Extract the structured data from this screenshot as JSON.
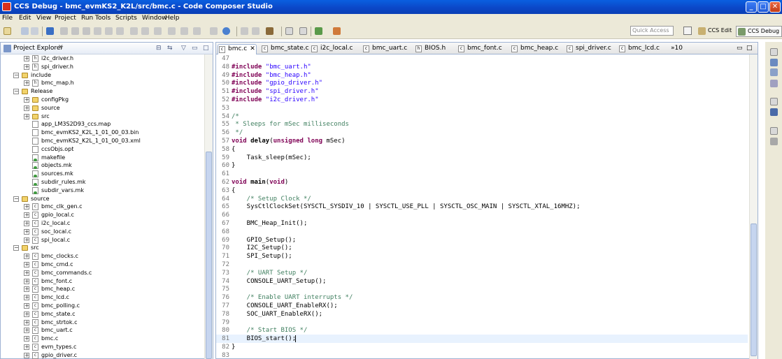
{
  "window": {
    "title": "CCS Debug - bmc_evmKS2_K2L/src/bmc.c - Code Composer Studio",
    "minimize": "_",
    "maximize": "□",
    "close": "✕"
  },
  "menu": [
    "File",
    "Edit",
    "View",
    "Project",
    "Run",
    "Tools",
    "Scripts",
    "Window",
    "Help"
  ],
  "toolbar": {
    "quick_access_placeholder": "Quick Access",
    "perspectives": [
      "CCS Edit",
      "CCS Debug"
    ]
  },
  "explorer": {
    "title": "Project Explorer",
    "close": "✕",
    "buttons": {
      "collapse": "⊟",
      "link": "⇆",
      "menu": "▽",
      "minimize": "▭",
      "maximize": "□"
    },
    "items": [
      {
        "label": "i2c_driver.h",
        "indent": 2,
        "icon": "hfile",
        "expand": "+"
      },
      {
        "label": "spi_driver.h",
        "indent": 2,
        "icon": "hfile",
        "expand": "+"
      },
      {
        "label": "include",
        "indent": 1,
        "icon": "folder",
        "expand": "−"
      },
      {
        "label": "bmc_map.h",
        "indent": 2,
        "icon": "hfile",
        "expand": "+"
      },
      {
        "label": "Release",
        "indent": 1,
        "icon": "folder",
        "expand": "−"
      },
      {
        "label": "configPkg",
        "indent": 2,
        "icon": "folder",
        "expand": "+"
      },
      {
        "label": "source",
        "indent": 2,
        "icon": "folder",
        "expand": "+"
      },
      {
        "label": "src",
        "indent": 2,
        "icon": "folder",
        "expand": "+"
      },
      {
        "label": "app_LM3S2D93_ccs.map",
        "indent": 2,
        "icon": "file",
        "expand": ""
      },
      {
        "label": "bmc_evmKS2_K2L_1_01_00_03.bin",
        "indent": 2,
        "icon": "file",
        "expand": ""
      },
      {
        "label": "bmc_evmKS2_K2L_1_01_00_03.xml",
        "indent": 2,
        "icon": "file",
        "expand": ""
      },
      {
        "label": "ccsObjs.opt",
        "indent": 2,
        "icon": "file",
        "expand": ""
      },
      {
        "label": "makefile",
        "indent": 2,
        "icon": "mk",
        "expand": ""
      },
      {
        "label": "objects.mk",
        "indent": 2,
        "icon": "mk",
        "expand": ""
      },
      {
        "label": "sources.mk",
        "indent": 2,
        "icon": "mk",
        "expand": ""
      },
      {
        "label": "subdir_rules.mk",
        "indent": 2,
        "icon": "mk",
        "expand": ""
      },
      {
        "label": "subdir_vars.mk",
        "indent": 2,
        "icon": "mk",
        "expand": ""
      },
      {
        "label": "source",
        "indent": 1,
        "icon": "folder",
        "expand": "−"
      },
      {
        "label": "bmc_clk_gen.c",
        "indent": 2,
        "icon": "cfile",
        "expand": "+"
      },
      {
        "label": "gpio_local.c",
        "indent": 2,
        "icon": "cfile",
        "expand": "+"
      },
      {
        "label": "i2c_local.c",
        "indent": 2,
        "icon": "cfile",
        "expand": "+"
      },
      {
        "label": "soc_local.c",
        "indent": 2,
        "icon": "cfile",
        "expand": "+"
      },
      {
        "label": "spi_local.c",
        "indent": 2,
        "icon": "cfile",
        "expand": "+"
      },
      {
        "label": "src",
        "indent": 1,
        "icon": "folder",
        "expand": "−"
      },
      {
        "label": "bmc_clocks.c",
        "indent": 2,
        "icon": "cfile",
        "expand": "+"
      },
      {
        "label": "bmc_cmd.c",
        "indent": 2,
        "icon": "cfile",
        "expand": "+"
      },
      {
        "label": "bmc_commands.c",
        "indent": 2,
        "icon": "cfile",
        "expand": "+"
      },
      {
        "label": "bmc_font.c",
        "indent": 2,
        "icon": "cfile",
        "expand": "+"
      },
      {
        "label": "bmc_heap.c",
        "indent": 2,
        "icon": "cfile",
        "expand": "+"
      },
      {
        "label": "bmc_lcd.c",
        "indent": 2,
        "icon": "cfile",
        "expand": "+"
      },
      {
        "label": "bmc_polling.c",
        "indent": 2,
        "icon": "cfile",
        "expand": "+"
      },
      {
        "label": "bmc_state.c",
        "indent": 2,
        "icon": "cfile",
        "expand": "+"
      },
      {
        "label": "bmc_strtok.c",
        "indent": 2,
        "icon": "cfile",
        "expand": "+"
      },
      {
        "label": "bmc_uart.c",
        "indent": 2,
        "icon": "cfile",
        "expand": "+"
      },
      {
        "label": "bmc.c",
        "indent": 2,
        "icon": "cfile",
        "expand": "+"
      },
      {
        "label": "evm_types.c",
        "indent": 2,
        "icon": "cfile",
        "expand": "+"
      },
      {
        "label": "gpio_driver.c",
        "indent": 2,
        "icon": "cfile",
        "expand": "+"
      }
    ]
  },
  "editor": {
    "tabs": [
      {
        "label": "bmc.c",
        "active": true,
        "close": "✕"
      },
      {
        "label": "bmc_state.c"
      },
      {
        "label": "i2c_local.c"
      },
      {
        "label": "bmc_uart.c"
      },
      {
        "label": "BIOS.h"
      },
      {
        "label": "bmc_font.c"
      },
      {
        "label": "bmc_heap.c"
      },
      {
        "label": "spi_driver.c"
      },
      {
        "label": "bmc_lcd.c"
      }
    ],
    "overflow": "»10",
    "current_line": 81,
    "lines": [
      {
        "n": "47",
        "parts": []
      },
      {
        "n": "48",
        "parts": [
          [
            "inc",
            "#include "
          ],
          [
            "str",
            "\"bmc_uart.h\""
          ]
        ]
      },
      {
        "n": "49",
        "parts": [
          [
            "inc",
            "#include "
          ],
          [
            "str",
            "\"bmc_heap.h\""
          ]
        ]
      },
      {
        "n": "50",
        "parts": [
          [
            "inc",
            "#include "
          ],
          [
            "str",
            "\"gpio_driver.h\""
          ]
        ]
      },
      {
        "n": "51",
        "parts": [
          [
            "inc",
            "#include "
          ],
          [
            "str",
            "\"spi_driver.h\""
          ]
        ]
      },
      {
        "n": "52",
        "parts": [
          [
            "inc",
            "#include "
          ],
          [
            "str",
            "\"i2c_driver.h\""
          ]
        ]
      },
      {
        "n": "53",
        "parts": []
      },
      {
        "n": "54",
        "parts": [
          [
            "cm",
            "/*"
          ]
        ]
      },
      {
        "n": "55",
        "parts": [
          [
            "cm",
            " * Sleeps for mSec milliseconds"
          ]
        ]
      },
      {
        "n": "56",
        "parts": [
          [
            "cm",
            " */"
          ]
        ]
      },
      {
        "n": "57",
        "parts": [
          [
            "kw",
            "void "
          ],
          [
            "b",
            "delay"
          ],
          [
            "",
            "("
          ],
          [
            "kw",
            "unsigned long "
          ],
          [
            "",
            "mSec)"
          ]
        ]
      },
      {
        "n": "58",
        "parts": [
          [
            "",
            "{"
          ]
        ]
      },
      {
        "n": "59",
        "parts": [
          [
            "",
            "    Task_sleep(mSec);"
          ]
        ]
      },
      {
        "n": "60",
        "parts": [
          [
            "",
            "}"
          ]
        ]
      },
      {
        "n": "61",
        "parts": []
      },
      {
        "n": "62",
        "parts": [
          [
            "kw",
            "void "
          ],
          [
            "b",
            "main"
          ],
          [
            "",
            "("
          ],
          [
            "kw",
            "void"
          ],
          [
            "",
            ")"
          ]
        ]
      },
      {
        "n": "63",
        "parts": [
          [
            "",
            "{"
          ]
        ]
      },
      {
        "n": "64",
        "parts": [
          [
            "cm",
            "    /* Setup Clock */"
          ]
        ]
      },
      {
        "n": "65",
        "parts": [
          [
            "",
            "    SysCtlClockSet(SYSCTL_SYSDIV_10 | SYSCTL_USE_PLL | SYSCTL_OSC_MAIN | SYSCTL_XTAL_16MHZ);"
          ]
        ]
      },
      {
        "n": "66",
        "parts": []
      },
      {
        "n": "67",
        "parts": [
          [
            "",
            "    BMC_Heap_Init();"
          ]
        ]
      },
      {
        "n": "68",
        "parts": []
      },
      {
        "n": "69",
        "parts": [
          [
            "",
            "    GPIO_Setup();"
          ]
        ]
      },
      {
        "n": "70",
        "parts": [
          [
            "",
            "    I2C_Setup();"
          ]
        ]
      },
      {
        "n": "71",
        "parts": [
          [
            "",
            "    SPI_Setup();"
          ]
        ]
      },
      {
        "n": "72",
        "parts": []
      },
      {
        "n": "73",
        "parts": [
          [
            "cm",
            "    /* UART Setup */"
          ]
        ]
      },
      {
        "n": "74",
        "parts": [
          [
            "",
            "    CONSOLE_UART_Setup();"
          ]
        ]
      },
      {
        "n": "75",
        "parts": []
      },
      {
        "n": "76",
        "parts": [
          [
            "cm",
            "    /* Enable UART interrupts */"
          ]
        ]
      },
      {
        "n": "77",
        "parts": [
          [
            "",
            "    CONSOLE_UART_EnableRX();"
          ]
        ]
      },
      {
        "n": "78",
        "parts": [
          [
            "",
            "    SOC_UART_EnableRX();"
          ]
        ]
      },
      {
        "n": "79",
        "parts": []
      },
      {
        "n": "80",
        "parts": [
          [
            "cm",
            "    /* Start BIOS */"
          ]
        ]
      },
      {
        "n": "81",
        "parts": [
          [
            "",
            "    BIOS_start();"
          ]
        ]
      },
      {
        "n": "82",
        "parts": [
          [
            "",
            "}"
          ]
        ]
      },
      {
        "n": "83",
        "parts": []
      }
    ]
  },
  "colors": {
    "keyword": "#7f0055",
    "string": "#2a00ff",
    "comment": "#3f7f5f",
    "current_line": "#e8f2fe",
    "titlebar": "#0b48c8"
  }
}
